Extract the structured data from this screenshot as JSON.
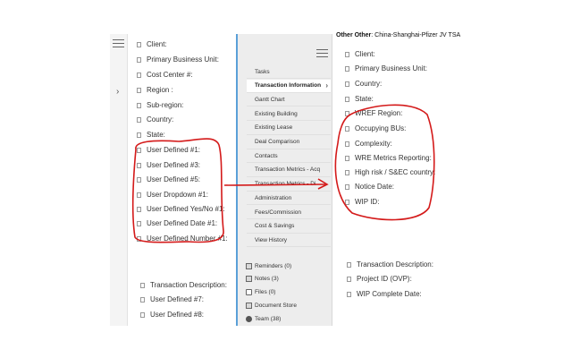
{
  "left_fields": [
    "Client:",
    "Primary Business Unit:",
    "Cost Center #:",
    "Region :",
    "Sub-region:",
    "Country:",
    "State:",
    "User Defined #1:",
    "User Defined #3:",
    "User Defined #5:",
    "User Dropdown #1:",
    "User Defined Yes/No #1:",
    "User Defined Date #1:",
    "User Defined Number #1:"
  ],
  "left_lower_fields": [
    "Transaction Description:",
    "User Defined #7:",
    "User Defined #8:"
  ],
  "nav_items": [
    "Tasks",
    "Transaction Information",
    "Gantt Chart",
    "Existing Building",
    "Existing Lease",
    "Deal Comparison",
    "Contacts",
    "Transaction Metrics - Acq",
    "Transaction Metrics - Di",
    "Administration",
    "Fees/Commission",
    "Cost & Savings",
    "View History"
  ],
  "nav_active_index": 1,
  "nav_bottom": [
    {
      "label": "Reminders (0)",
      "icon": "bell-icon"
    },
    {
      "label": "Notes (3)",
      "icon": "note-icon"
    },
    {
      "label": "Files (0)",
      "icon": "folder-icon"
    },
    {
      "label": "Document Store",
      "icon": "document-icon"
    },
    {
      "label": "Team (38)",
      "icon": "team-icon"
    }
  ],
  "header": {
    "label": "Other Other",
    "value": ": China-Shanghai-Pfizer JV TSA"
  },
  "right_fields": [
    "Client:",
    "Primary Business Unit:",
    "Country:",
    "State:",
    "WREF Region:",
    "Occupying BUs:",
    "Complexity:",
    "WRE Metrics Reporting:",
    "High risk / S&EC country:",
    "Notice Date:",
    "WIP ID:"
  ],
  "right_lower_fields": [
    "Transaction Description:",
    "Project ID (OVP):",
    "WIP Complete Date:"
  ],
  "colors": {
    "annotation": "#d41a1a",
    "divider": "#5aa0d8",
    "nav_bg": "#ededed"
  }
}
